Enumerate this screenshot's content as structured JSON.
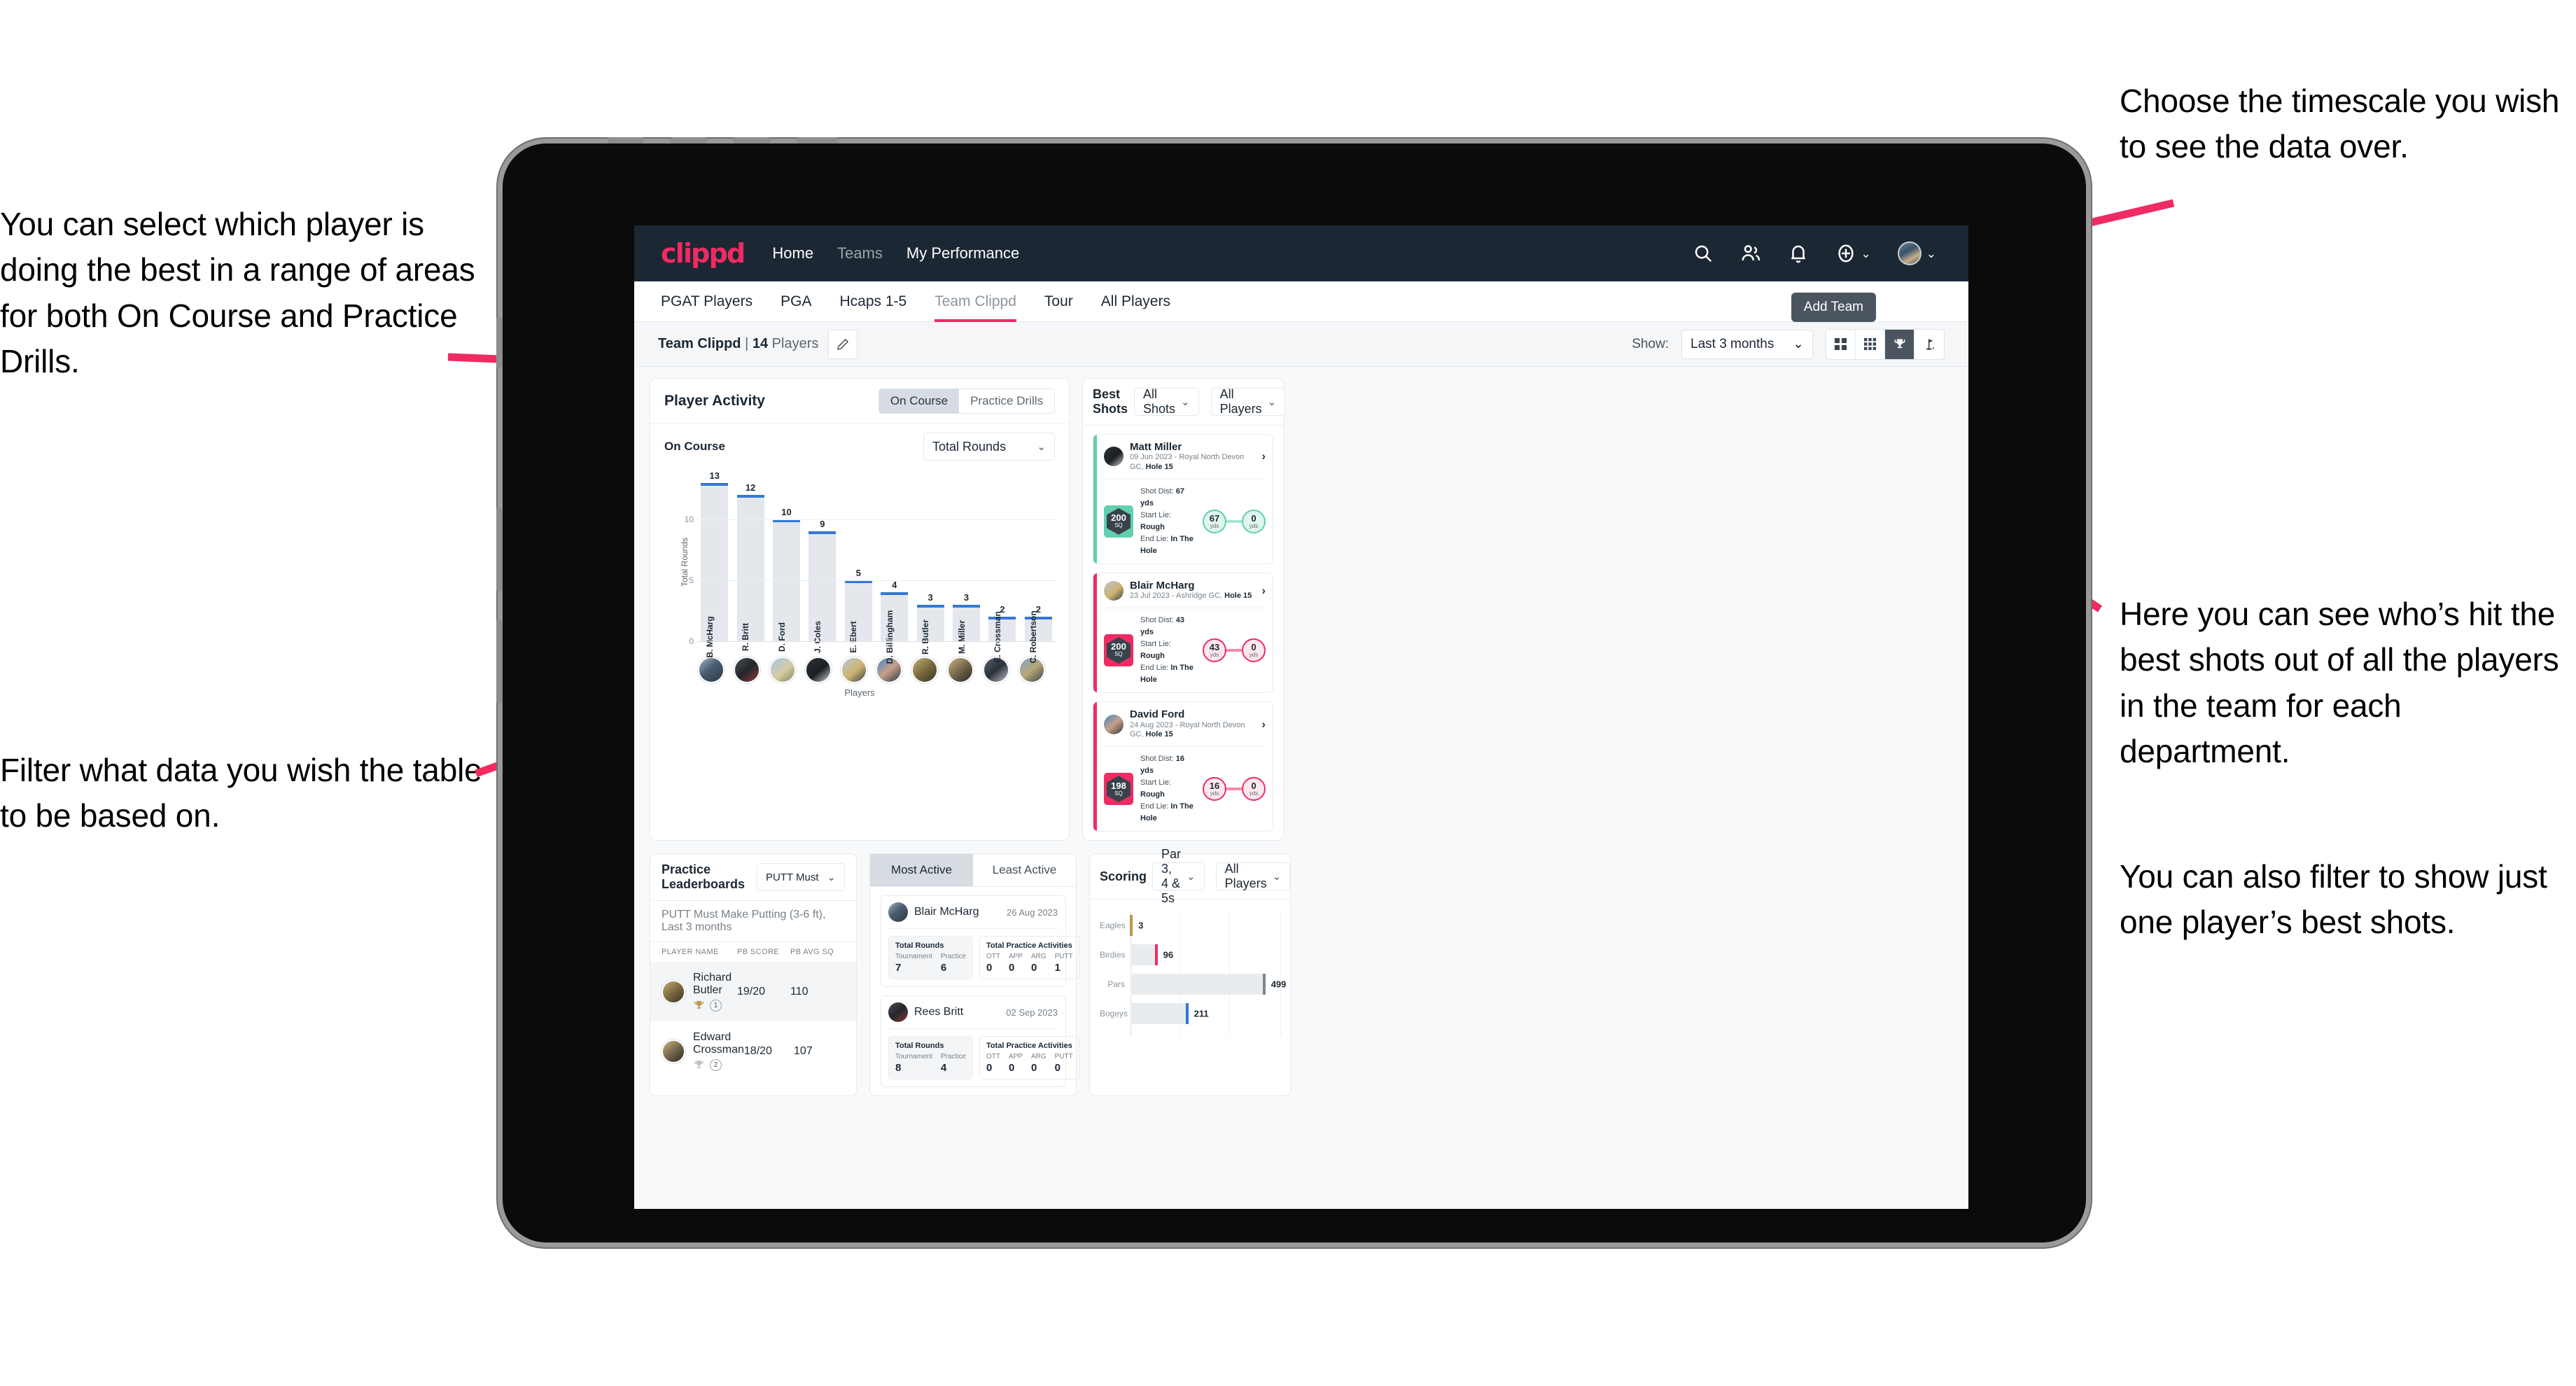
{
  "annotations": {
    "left_top": "You can select which player is doing the best in a range of areas for both On Course and Practice Drills.",
    "left_bottom": "Filter what data you wish the table to be based on.",
    "right_top": "Choose the timescale you wish to see the data over.",
    "right_middle": "Here you can see who’s hit the best shots out of all the players in the team for each department.",
    "right_bottom": "You can also filter to show just one player’s best shots."
  },
  "navbar": {
    "logo": "clippd",
    "links": [
      {
        "label": "Home",
        "active": true
      },
      {
        "label": "Teams",
        "active": false
      },
      {
        "label": "My Performance",
        "active": true
      }
    ],
    "icons": [
      "search-icon",
      "people-icon",
      "bell-icon",
      "plus-circle-icon",
      "avatar"
    ]
  },
  "subnav": {
    "tabs": [
      {
        "label": "PGAT Players",
        "active": false
      },
      {
        "label": "PGA",
        "active": false
      },
      {
        "label": "Hcaps 1-5",
        "active": false
      },
      {
        "label": "Team Clippd",
        "active": true
      },
      {
        "label": "Tour",
        "active": false
      },
      {
        "label": "All Players",
        "active": false
      }
    ],
    "tooltip": "Add Team"
  },
  "toolbar": {
    "team_name": "Team Clippd",
    "separator": "|",
    "player_count": "14",
    "players_word": "Players",
    "edit_icon": "pencil-icon",
    "show_label": "Show:",
    "timescale_value": "Last 3 months",
    "view_buttons": [
      {
        "icon": "grid-2x2-icon",
        "active": false
      },
      {
        "icon": "grid-3x3-icon",
        "active": false
      },
      {
        "icon": "trophy-icon",
        "active": true
      },
      {
        "icon": "flag-icon",
        "active": false
      }
    ]
  },
  "player_activity": {
    "title": "Player Activity",
    "toggle": [
      {
        "label": "On Course",
        "active": true
      },
      {
        "label": "Practice Drills",
        "active": false
      }
    ],
    "section_label": "On Course",
    "metric_select": "Total Rounds"
  },
  "chart_data": [
    {
      "type": "bar",
      "title": "Player Activity — On Course",
      "categories": [
        "B. McHarg",
        "R. Britt",
        "D. Ford",
        "J. Coles",
        "E. Ebert",
        "D. Billingham",
        "R. Butler",
        "M. Miller",
        "E. Crossman",
        "C. Robertson"
      ],
      "values": [
        13,
        12,
        10,
        9,
        5,
        4,
        3,
        3,
        2,
        2
      ],
      "xlabel": "Players",
      "ylabel": "Total Rounds",
      "yticks": [
        0,
        5,
        10
      ],
      "ylim": [
        0,
        14
      ],
      "grid": true,
      "bar_color": "#e4e7eb",
      "cap_color": "#3478d4"
    },
    {
      "type": "bar",
      "orientation": "horizontal",
      "title": "Scoring",
      "categories": [
        "Eagles",
        "Birdies",
        "Pars",
        "Bogeys"
      ],
      "values": [
        3,
        96,
        499,
        211
      ],
      "cap_colors": [
        "#b99a4a",
        "#ef2b62",
        "#7b858e",
        "#3478d4"
      ],
      "xlim": [
        0,
        560
      ],
      "grid": true
    }
  ],
  "best_shots": {
    "title": "Best Shots",
    "filter_shots": "All Shots",
    "filter_players": "All Players",
    "items": [
      {
        "name": "Matt Miller",
        "meta_date": "09 Jun 2023 - Royal North Devon GC,",
        "meta_hole": "Hole 15",
        "sq": "200",
        "sq_unit": "SQ",
        "shot_dist_label": "Shot Dist:",
        "shot_dist": "67 yds",
        "start_lie_label": "Start Lie:",
        "start_lie": "Rough",
        "end_lie_label": "End Lie:",
        "end_lie": "In The Hole",
        "from_val": "67",
        "from_unit": "yds",
        "to_val": "0",
        "to_unit": "yds",
        "accent": "#5fcfb0"
      },
      {
        "name": "Blair McHarg",
        "meta_date": "23 Jul 2023 - Ashridge GC,",
        "meta_hole": "Hole 15",
        "sq": "200",
        "sq_unit": "SQ",
        "shot_dist_label": "Shot Dist:",
        "shot_dist": "43 yds",
        "start_lie_label": "Start Lie:",
        "start_lie": "Rough",
        "end_lie_label": "End Lie:",
        "end_lie": "In The Hole",
        "from_val": "43",
        "from_unit": "yds",
        "to_val": "0",
        "to_unit": "yds",
        "accent": "#ef2b62"
      },
      {
        "name": "David Ford",
        "meta_date": "24 Aug 2023 - Royal North Devon GC,",
        "meta_hole": "Hole 15",
        "sq": "198",
        "sq_unit": "SQ",
        "shot_dist_label": "Shot Dist:",
        "shot_dist": "16 yds",
        "start_lie_label": "Start Lie:",
        "start_lie": "Rough",
        "end_lie_label": "End Lie:",
        "end_lie": "In The Hole",
        "from_val": "16",
        "from_unit": "yds",
        "to_val": "0",
        "to_unit": "yds",
        "accent": "#ef2b62"
      }
    ]
  },
  "practice_leaderboards": {
    "title": "Practice Leaderboards",
    "drill_select": "PUTT Must Make Putting ...",
    "subtitle_bold": "PUTT Must Make Putting (3-6 ft),",
    "subtitle_light": "Last 3 months",
    "columns": [
      "PLAYER NAME",
      "PB SCORE",
      "PB AVG SQ"
    ],
    "rows": [
      {
        "name": "Richard Butler",
        "rank": "1",
        "pb_score": "19/20",
        "pb_avg_sq": "110",
        "trophy": "gold"
      },
      {
        "name": "Edward Crossman",
        "rank": "2",
        "pb_score": "18/20",
        "pb_avg_sq": "107",
        "trophy": "silver"
      }
    ]
  },
  "activity": {
    "tabs": [
      {
        "label": "Most Active",
        "active": true
      },
      {
        "label": "Least Active",
        "active": false
      }
    ],
    "items": [
      {
        "name": "Blair McHarg",
        "date": "26 Aug 2023",
        "rounds_title": "Total Rounds",
        "rounds_cols": [
          "Tournament",
          "Practice"
        ],
        "rounds_vals": [
          "7",
          "6"
        ],
        "practice_title": "Total Practice Activities",
        "practice_cols": [
          "OTT",
          "APP",
          "ARG",
          "PUTT"
        ],
        "practice_vals": [
          "0",
          "0",
          "0",
          "1"
        ]
      },
      {
        "name": "Rees Britt",
        "date": "02 Sep 2023",
        "rounds_title": "Total Rounds",
        "rounds_cols": [
          "Tournament",
          "Practice"
        ],
        "rounds_vals": [
          "8",
          "4"
        ],
        "practice_title": "Total Practice Activities",
        "practice_cols": [
          "OTT",
          "APP",
          "ARG",
          "PUTT"
        ],
        "practice_vals": [
          "0",
          "0",
          "0",
          "0"
        ]
      }
    ]
  },
  "scoring": {
    "title": "Scoring",
    "filter_par": "Par 3, 4 & 5s",
    "filter_players": "All Players"
  }
}
